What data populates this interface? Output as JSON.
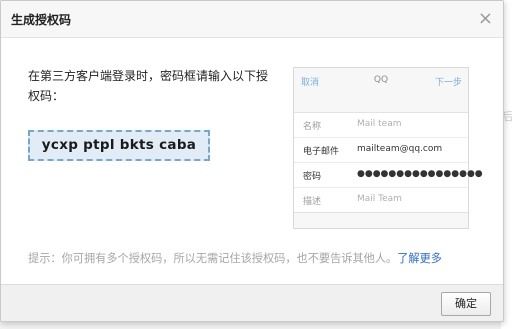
{
  "dialog": {
    "title": "生成授权码",
    "close_label": "×",
    "intro_text": "在第三方客户端登录时，密码框请输入以下授权码：",
    "auth_code": "ycxp ptpl bkts caba",
    "tip_text": "提示：你可拥有多个授权码，所以无需记住该授权码，也不要告诉其他人。",
    "tip_link": "了解更多",
    "ok_label": "确定"
  },
  "phone": {
    "cancel": "取消",
    "title": "QQ",
    "next": "下一步",
    "rows": [
      {
        "label": "名称",
        "value": "Mail team"
      },
      {
        "label": "电子邮件",
        "value": "mailteam@qq.com"
      },
      {
        "label": "密码",
        "value": "●●●●●●●●●●●●●●●●"
      },
      {
        "label": "描述",
        "value": "Mail Team"
      }
    ]
  },
  "background": {
    "hint_char": "后"
  },
  "colors": {
    "link": "#2f6ec2",
    "code_bg": "#e1ecf6",
    "code_border": "#79a6cc"
  }
}
